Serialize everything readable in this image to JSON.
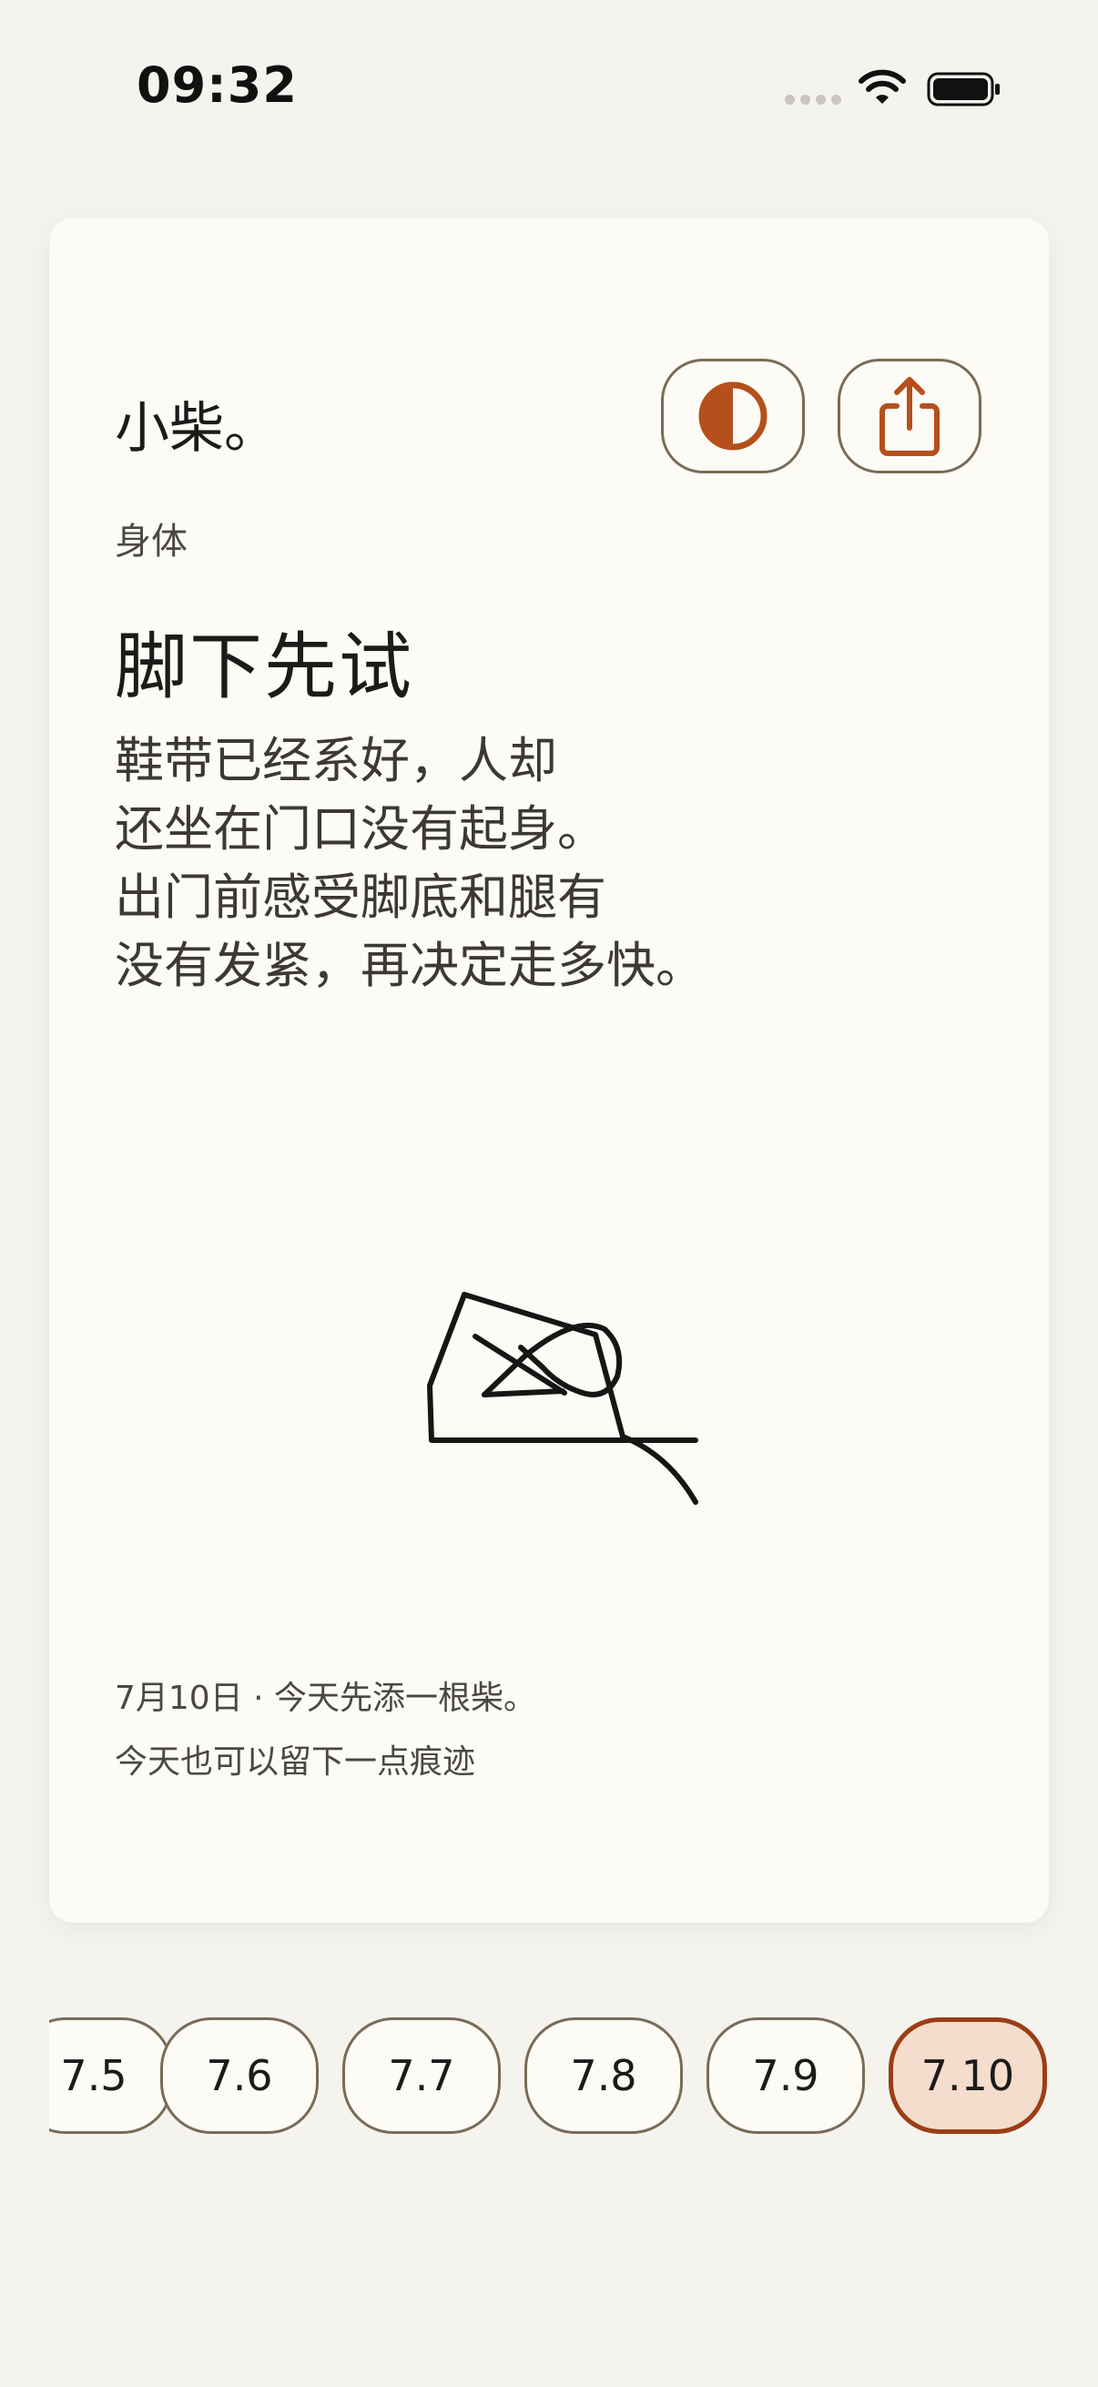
{
  "status_bar": {
    "time": "09:32"
  },
  "card": {
    "brand": "小柴。",
    "category": "身体",
    "title": "脚下先试",
    "body_lines": [
      "鞋带已经系好，人却",
      "还坐在门口没有起身。",
      "出门前感受脚底和腿有",
      "没有发紧，再决定走多快。"
    ],
    "footer_line1": "7月10日 · 今天先添一根柴。",
    "footer_line2": "今天也可以留下一点痕迹",
    "buttons": {
      "theme_icon": "half-circle-contrast-icon",
      "share_icon": "share-icon"
    },
    "illustration_icon": "shoe-sketch-icon"
  },
  "date_strip": {
    "dates": [
      "7.5",
      "7.6",
      "7.7",
      "7.8",
      "7.9",
      "7.10"
    ],
    "selected": "7.10"
  },
  "colors": {
    "accent": "#B5501C",
    "accent_dark": "#9A3E16",
    "selected_fill": "#F4DDCC",
    "outline": "#7A6B57",
    "card_bg": "#FDFBF5",
    "page_bg": "#F5F3ED"
  }
}
